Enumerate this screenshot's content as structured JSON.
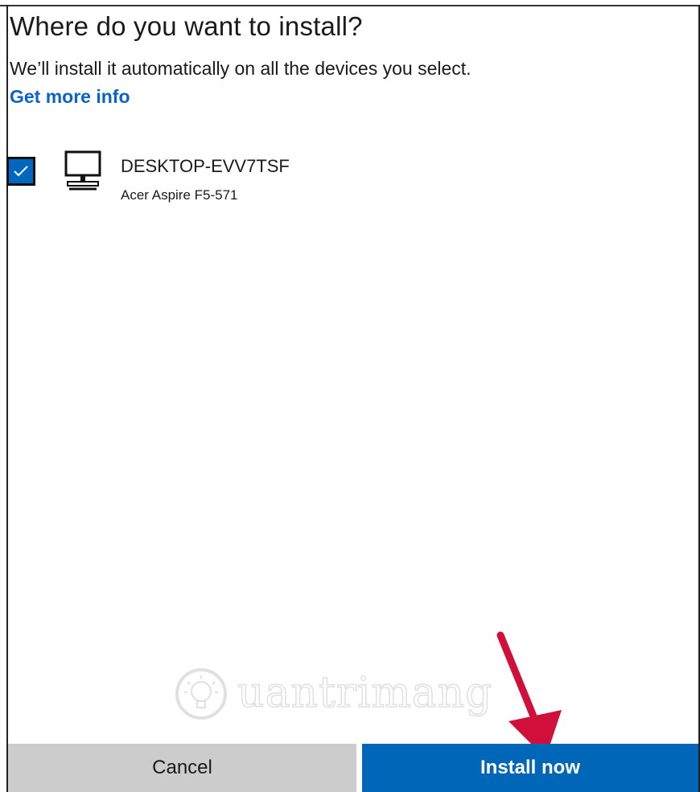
{
  "dialog": {
    "title": "Where do you want to install?",
    "subtitle": "We’ll install it automatically on all the devices you select.",
    "more_info_link": "Get more info"
  },
  "devices": [
    {
      "name": "DESKTOP-EVV7TSF",
      "model": "Acer Aspire F5-571",
      "checked": true,
      "icon": "desktop-computer-icon"
    }
  ],
  "buttons": {
    "cancel_label": "Cancel",
    "install_label": "Install now"
  },
  "watermark": {
    "text": "uantrimang",
    "icon": "lightbulb-icon"
  },
  "colors": {
    "accent": "#0067b8",
    "link": "#0a63c9",
    "cancel_bg": "#cccccc",
    "annotation_arrow": "#d0103a"
  }
}
